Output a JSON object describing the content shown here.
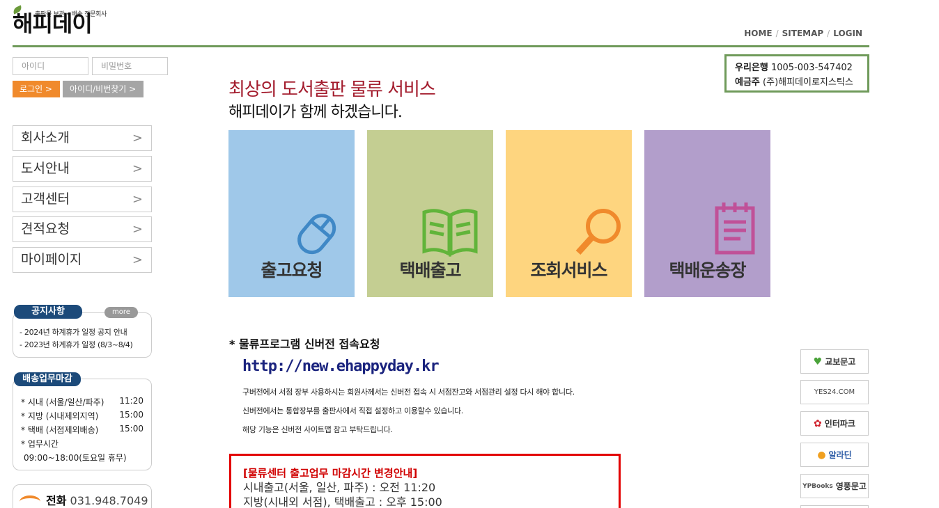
{
  "header": {
    "logo_tagline": "출판물 보관 • 배송 전문회사",
    "logo_text": "해피데이",
    "nav": [
      "HOME",
      "SITEMAP",
      "LOGIN"
    ]
  },
  "login": {
    "id_placeholder": "아이디",
    "pw_placeholder": "비밀번호",
    "login_label": "로그인 >",
    "find_label": "아이디/비번찾기 >"
  },
  "side_menu": [
    {
      "label": "회사소개"
    },
    {
      "label": "도서안내"
    },
    {
      "label": "고객센터"
    },
    {
      "label": "견적요청"
    },
    {
      "label": "마이페이지"
    }
  ],
  "notices": {
    "title": "공지사항",
    "more": "more",
    "items": [
      "- 2024년 하계휴가 일정 공지 안내",
      "- 2023년 하계휴가 일정 (8/3~8/4)"
    ]
  },
  "deadline": {
    "title": "배송업무마감",
    "rows": [
      {
        "label": "* 시내 (서울/일산/파주)",
        "time": "11:20"
      },
      {
        "label": "* 지방 (시내제외지역)",
        "time": "15:00"
      },
      {
        "label": "* 택배 (서점제외배송)",
        "time": "15:00"
      }
    ],
    "hours_label": "* 업무시간",
    "hours": "09:00~18:00(토요일 휴무)"
  },
  "phone": {
    "label": "전화",
    "number": "031.948.7049"
  },
  "bank": {
    "bank_label": "우리은행",
    "account": "1005-003-547402",
    "holder_label": "예금주",
    "holder": "(주)해피데이로지스틱스"
  },
  "hero": {
    "headline": "최상의 도서출판 물류 서비스",
    "subline": "해피데이가 함께 하겠습니다."
  },
  "tiles": [
    {
      "label": "출고요청",
      "icon": "mouse-icon",
      "bg": "#9fc8e9"
    },
    {
      "label": "택배출고",
      "icon": "book-icon",
      "bg": "#c4ce92"
    },
    {
      "label": "조회서비스",
      "icon": "magnifier-icon",
      "bg": "#fed57f"
    },
    {
      "label": "택배운송장",
      "icon": "notepad-icon",
      "bg": "#b29ecb"
    }
  ],
  "program": {
    "title": "* 물류프로그램 신버전 접속요청",
    "url": "http://new.ehappyday.kr",
    "desc": [
      "구버전에서 서점 장부 사용하시는 회원사께서는 신버전 접속 시 서점잔고와 서점관리 설정 다시 해야 합니다.",
      "신버전에서는 통합장부를 출판사에서 직접 설정하고 이용할수 있습니다.",
      "해당 기능은 신버전 사이트맵 참고 부탁드립니다."
    ]
  },
  "closing_notice": {
    "title": "[물류센터 출고업무 마감시간 변경안내]",
    "lines": [
      "시내출고(서울, 일산, 파주) : 오전 11:20",
      "지방(시내외 서점), 택배출고 : 오후 15:00"
    ]
  },
  "stores": [
    "교보문고",
    "YES24.COM",
    "인터파크",
    "알라딘",
    "영풍문고"
  ],
  "store_yp_prefix": "YPBooks"
}
